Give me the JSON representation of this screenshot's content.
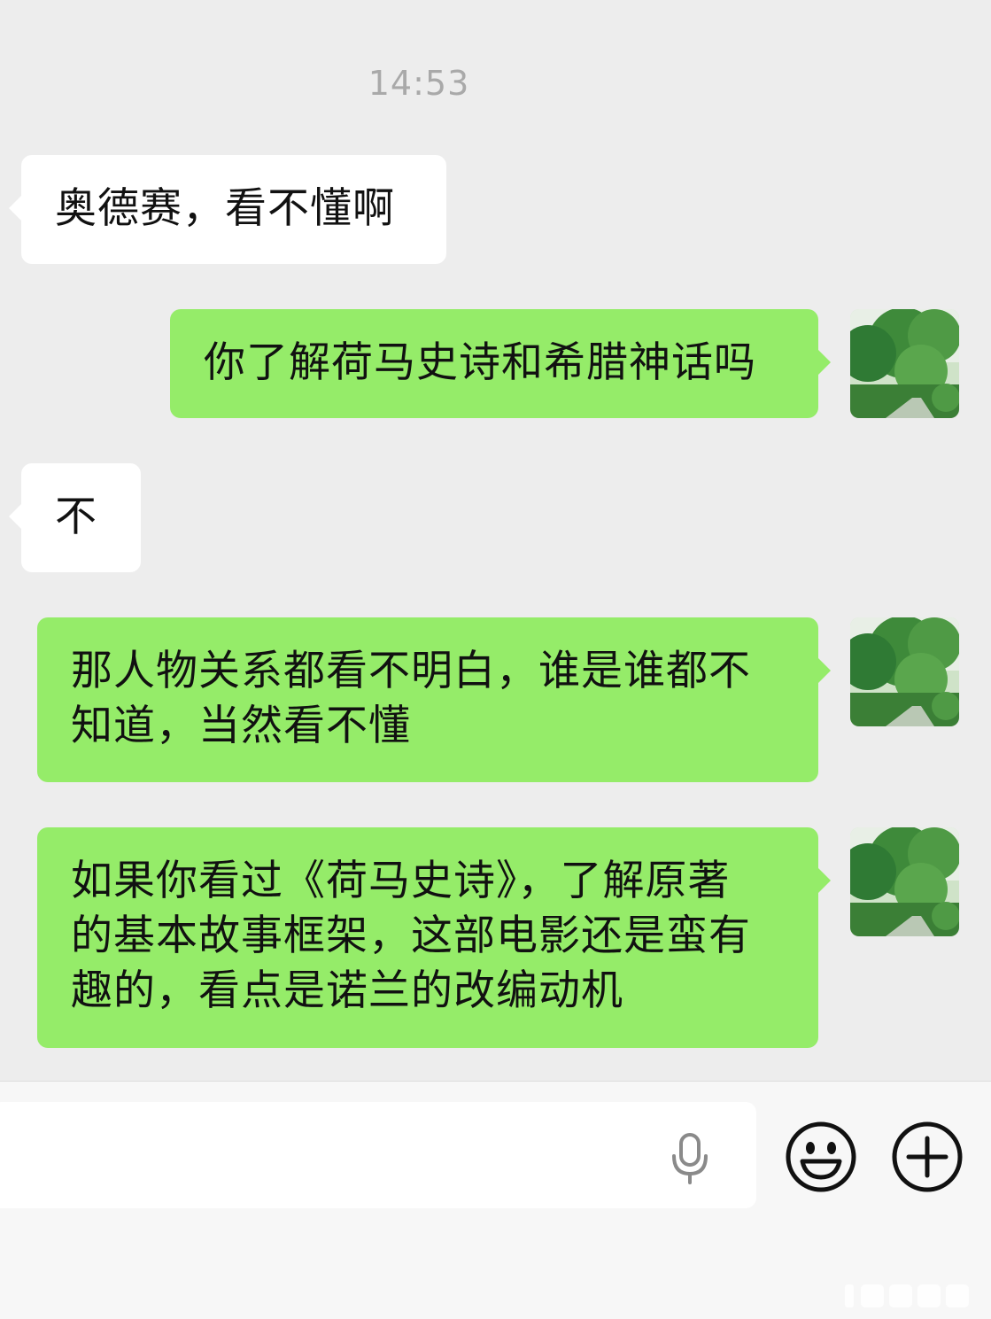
{
  "chat": {
    "timestamp": "14:53",
    "messages": [
      {
        "side": "left",
        "text": "奥德赛，看不懂啊"
      },
      {
        "side": "right",
        "text": "你了解荷马史诗和希腊神话吗"
      },
      {
        "side": "left",
        "text": "不"
      },
      {
        "side": "right",
        "lines": [
          "那人物关系都看不明白，谁是谁都不",
          "知道，当然看不懂"
        ]
      },
      {
        "side": "right",
        "lines": [
          "如果你看过《荷马史诗》，了解原著",
          "的基本故事框架，这部电影还是蛮有",
          "趣的，看点是诺兰的改编动机"
        ]
      }
    ]
  },
  "input_bar": {
    "input_value": "",
    "icons": {
      "voice": "microphone-icon",
      "emoji": "smiley-face-icon",
      "more": "plus-icon"
    }
  },
  "colors": {
    "background": "#ededed",
    "sent_bubble": "#95ec69",
    "received_bubble": "#ffffff",
    "timestamp": "#a9a9a9"
  }
}
